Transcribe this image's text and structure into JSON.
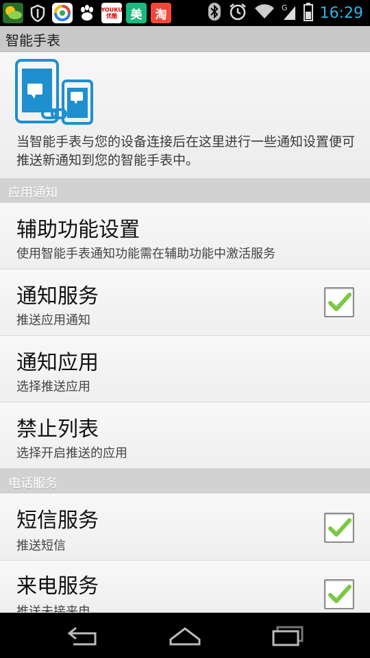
{
  "status_bar": {
    "time": "16:29",
    "left_icons": [
      "weather-app-icon",
      "shield-icon",
      "browser-icon",
      "baidu-paw-icon",
      "youku-icon",
      "meituan-icon",
      "taobao-icon"
    ],
    "youku_label": "YOUKU\n优酷",
    "meituan_label": "美",
    "taobao_label": "淘",
    "right_icons": [
      "bluetooth-icon",
      "alarm-icon",
      "wifi-icon",
      "signal-icon",
      "battery-icon"
    ]
  },
  "title_bar": {
    "title": "智能手表"
  },
  "header": {
    "description": "当智能手表与您的设备连接后在这里进行一些通知设置便可推送新通知到您的智能手表中。"
  },
  "sections": [
    {
      "title": "应用通知",
      "items": [
        {
          "title": "辅助功能设置",
          "subtitle": "使用智能手表通知功能需在辅助功能中激活服务"
        },
        {
          "title": "通知服务",
          "subtitle": "推送应用通知",
          "checked": true
        },
        {
          "title": "通知应用",
          "subtitle": "选择推送应用"
        },
        {
          "title": "禁止列表",
          "subtitle": "选择开启推送的应用"
        }
      ]
    },
    {
      "title": "电话服务",
      "items": [
        {
          "title": "短信服务",
          "subtitle": "推送短信",
          "checked": true
        },
        {
          "title": "来电服务",
          "subtitle": "推送未接来电",
          "checked": true
        }
      ]
    }
  ],
  "nav_bar": {
    "buttons": [
      "back-icon",
      "home-icon",
      "recents-icon"
    ]
  },
  "colors": {
    "status_accent": "#33b5e5",
    "check_green": "#7ac943",
    "device_blue": "#1e8fcf"
  }
}
